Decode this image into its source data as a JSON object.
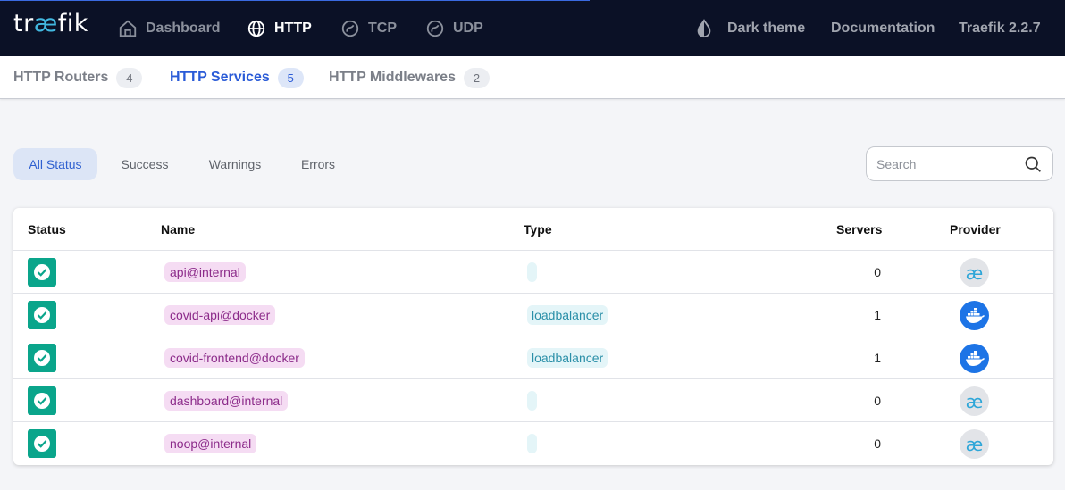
{
  "header": {
    "logo": {
      "pre": "tr",
      "ae": "æ",
      "post": "fik"
    },
    "nav": [
      {
        "label": "Dashboard",
        "icon": "home-icon",
        "active": false
      },
      {
        "label": "HTTP",
        "icon": "globe-icon",
        "active": true
      },
      {
        "label": "TCP",
        "icon": "tcp-icon",
        "active": false
      },
      {
        "label": "UDP",
        "icon": "udp-icon",
        "active": false
      }
    ],
    "theme_label": "Dark theme",
    "theme_icon": "theme-drop-icon",
    "documentation": "Documentation",
    "version": "Traefik 2.2.7"
  },
  "subnav": [
    {
      "label": "HTTP Routers",
      "count": "4",
      "active": false
    },
    {
      "label": "HTTP Services",
      "count": "5",
      "active": true
    },
    {
      "label": "HTTP Middlewares",
      "count": "2",
      "active": false
    }
  ],
  "filters": [
    {
      "label": "All Status",
      "active": true
    },
    {
      "label": "Success",
      "active": false
    },
    {
      "label": "Warnings",
      "active": false
    },
    {
      "label": "Errors",
      "active": false
    }
  ],
  "search": {
    "placeholder": "Search",
    "value": "",
    "icon": "search-icon"
  },
  "table": {
    "headers": {
      "status": "Status",
      "name": "Name",
      "type": "Type",
      "servers": "Servers",
      "provider": "Provider"
    },
    "rows": [
      {
        "status": "success",
        "name": "api@internal",
        "type": "",
        "servers": "0",
        "provider": "internal",
        "provider_glyph": "æ"
      },
      {
        "status": "success",
        "name": "covid-api@docker",
        "type": "loadbalancer",
        "servers": "1",
        "provider": "docker",
        "provider_glyph": ""
      },
      {
        "status": "success",
        "name": "covid-frontend@docker",
        "type": "loadbalancer",
        "servers": "1",
        "provider": "docker",
        "provider_glyph": ""
      },
      {
        "status": "success",
        "name": "dashboard@internal",
        "type": "",
        "servers": "0",
        "provider": "internal",
        "provider_glyph": "æ"
      },
      {
        "status": "success",
        "name": "noop@internal",
        "type": "",
        "servers": "0",
        "provider": "internal",
        "provider_glyph": "æ"
      }
    ]
  },
  "colors": {
    "topbar": "#0b1126",
    "accent": "#2a5bd7",
    "success": "#0aa58b",
    "name_chip": "#f5dcf3",
    "type_chip": "#e4f5f8",
    "docker": "#1d74e6"
  }
}
